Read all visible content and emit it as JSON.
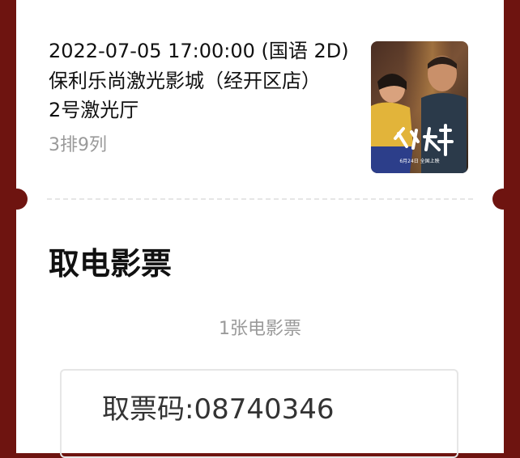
{
  "show": {
    "datetime": "2022-07-05 17:00:00 (国语 2D)",
    "cinema": "保利乐尚激光影城（经开区店）",
    "hall": "2号激光厅",
    "seat": "3排9列"
  },
  "poster": {
    "title_art": "人生大事",
    "release_text": "6月24日 全国上映"
  },
  "pickup": {
    "title": "取电影票",
    "count": "1张电影票",
    "code_label": "取票码:",
    "code": "08740346"
  },
  "colors": {
    "background": "#6e1410",
    "card": "#ffffff",
    "muted_text": "#9a9a9a"
  }
}
